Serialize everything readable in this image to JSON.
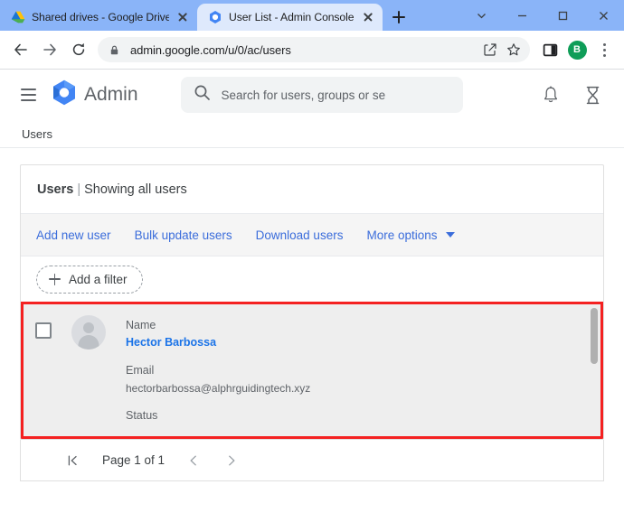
{
  "browser": {
    "tabs": [
      {
        "title": "Shared drives - Google Drive",
        "favicon": "google-drive-icon",
        "active": false
      },
      {
        "title": "User List - Admin Console",
        "favicon": "google-admin-icon",
        "active": true
      }
    ],
    "newtab_label": "+",
    "window_controls": [
      "tab-search-chevron",
      "minimize",
      "maximize",
      "close"
    ],
    "omnibox": {
      "url": "admin.google.com/u/0/ac/users",
      "lock_icon": "lock-icon",
      "share_icon": "share-icon",
      "bookmark_icon": "star-icon"
    },
    "toolbar_icons": [
      "back-arrow",
      "forward-arrow",
      "reload"
    ],
    "side_panel_icon": "side-panel-icon",
    "profile_initial": "B",
    "menu_icon": "three-dot-menu-icon"
  },
  "app": {
    "brand": "Admin",
    "menu_icon": "hamburger-menu-icon",
    "logo_icon": "admin-hexagon-logo",
    "search": {
      "placeholder": "Search for users, groups or se",
      "icon": "search-icon"
    },
    "notifications_icon": "bell-icon",
    "tasks_icon": "hourglass-icon",
    "breadcrumb": "Users"
  },
  "card": {
    "title": "Users",
    "separator": "|",
    "subtitle": "Showing all users",
    "actions": [
      {
        "label": "Add new user",
        "has_caret": false
      },
      {
        "label": "Bulk update users",
        "has_caret": false
      },
      {
        "label": "Download users",
        "has_caret": false
      },
      {
        "label": "More options",
        "has_caret": true
      }
    ],
    "filter": {
      "label": "Add a filter",
      "icon": "plus-icon"
    }
  },
  "user_row": {
    "checkbox_checked": false,
    "avatar_icon": "person-placeholder-avatar",
    "fields": {
      "name_label": "Name",
      "name_value": "Hector Barbossa",
      "email_label": "Email",
      "email_value": "hectorbarbossa@alphrguidingtech.xyz",
      "status_label": "Status"
    }
  },
  "pagination": {
    "first_icon": "first-page-icon",
    "prev_icon": "previous-page-icon",
    "next_icon": "next-page-icon",
    "label": "Page 1 of 1"
  },
  "colors": {
    "highlight_border": "#f42121",
    "link_blue": "#1a73e8",
    "action_blue": "#3b6ddb",
    "tab_strip": "#8ab4f8",
    "profile_green": "#0f9d58"
  }
}
